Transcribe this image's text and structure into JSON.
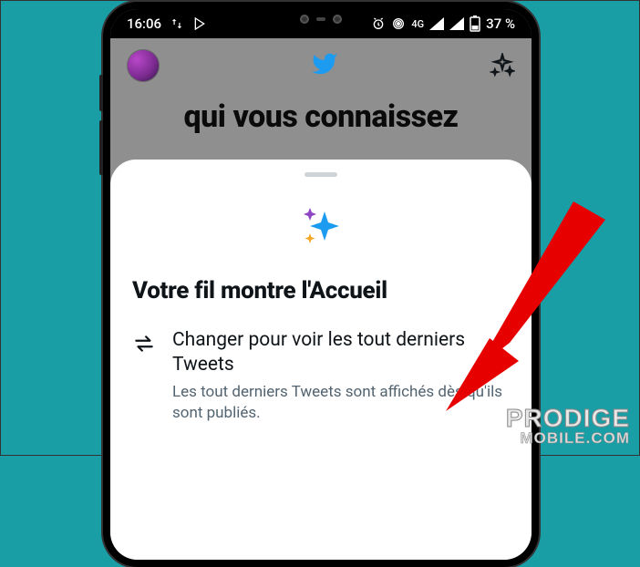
{
  "status": {
    "time": "16:06",
    "network_label": "4G",
    "battery_text": "37 %"
  },
  "feed": {
    "partial_text": "qui vous connaissez"
  },
  "sheet": {
    "title": "Votre fil montre l'Accueil",
    "option_title": "Changer pour voir les tout derniers Tweets",
    "option_subtitle": "Les tout derniers Tweets sont affichés dès qu'ils sont publiés."
  },
  "watermark": {
    "line1": "PRODIGE",
    "line2": "MOBILE.COM"
  }
}
